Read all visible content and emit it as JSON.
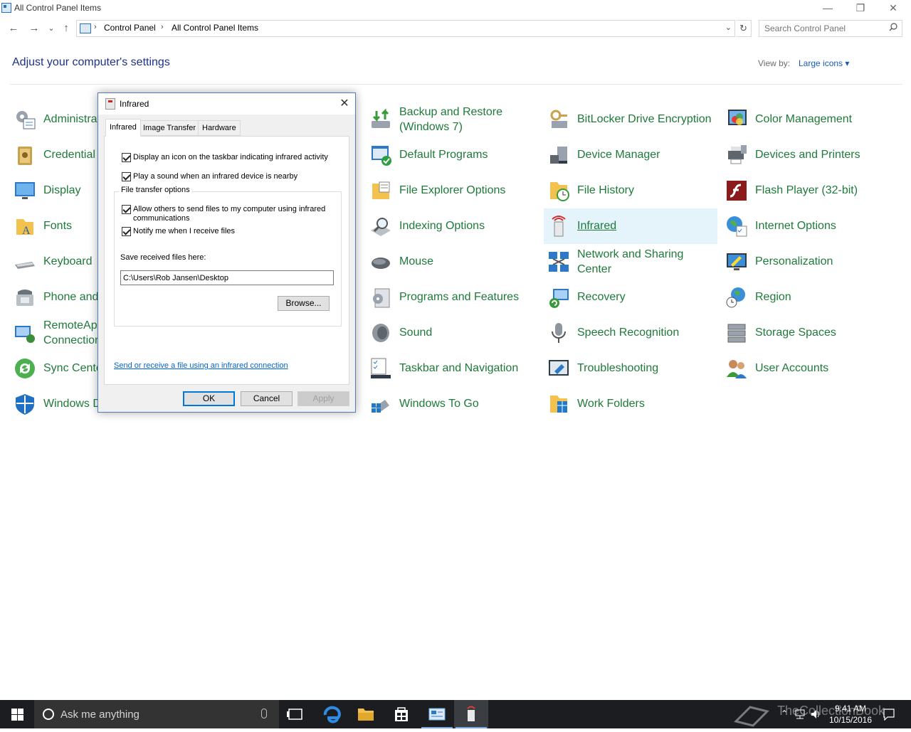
{
  "window": {
    "title": "All Control Panel Items",
    "controls": {
      "minimize": "—",
      "restore": "❐",
      "close": "✕"
    }
  },
  "nav": {
    "back": "←",
    "forward": "→",
    "recent": "⌄",
    "up": "↑",
    "breadcrumb": [
      "Control Panel",
      "All Control Panel Items"
    ],
    "refresh": "↻",
    "search_placeholder": "Search Control Panel"
  },
  "header": {
    "title": "Adjust your computer's settings",
    "view_by_label": "View by:",
    "view_by_value": "Large icons ▾"
  },
  "items": [
    {
      "label": "Administrative Tools",
      "icon": "admin-tools-icon"
    },
    {
      "label": "Credential Manager",
      "icon": "credential-icon"
    },
    {
      "label": "Display",
      "icon": "display-icon"
    },
    {
      "label": "Fonts",
      "icon": "fonts-icon"
    },
    {
      "label": "Keyboard",
      "icon": "keyboard-icon"
    },
    {
      "label": "Phone and Modem",
      "icon": "phone-icon"
    },
    {
      "label": "RemoteApp and Desktop Connections",
      "icon": "remoteapp-icon"
    },
    {
      "label": "Sync Center",
      "icon": "sync-icon"
    },
    {
      "label": "Windows Defender",
      "icon": "shield-icon"
    },
    {
      "label": "Backup and Restore (Windows 7)",
      "icon": "backup-icon"
    },
    {
      "label": "Default Programs",
      "icon": "default-programs-icon"
    },
    {
      "label": "File Explorer Options",
      "icon": "folder-options-icon"
    },
    {
      "label": "Indexing Options",
      "icon": "indexing-icon"
    },
    {
      "label": "Mouse",
      "icon": "mouse-icon"
    },
    {
      "label": "Programs and Features",
      "icon": "programs-icon"
    },
    {
      "label": "Sound",
      "icon": "speaker-icon"
    },
    {
      "label": "Taskbar and Navigation",
      "icon": "taskbar-icon"
    },
    {
      "label": "Windows To Go",
      "icon": "usb-icon"
    },
    {
      "label": "BitLocker Drive Encryption",
      "icon": "bitlocker-icon"
    },
    {
      "label": "Device Manager",
      "icon": "device-manager-icon"
    },
    {
      "label": "File History",
      "icon": "file-history-icon"
    },
    {
      "label": "Infrared",
      "icon": "infrared-icon"
    },
    {
      "label": "Network and Sharing Center",
      "icon": "network-icon"
    },
    {
      "label": "Recovery",
      "icon": "recovery-icon"
    },
    {
      "label": "Speech Recognition",
      "icon": "microphone-icon"
    },
    {
      "label": "Troubleshooting",
      "icon": "troubleshooting-icon"
    },
    {
      "label": "Work Folders",
      "icon": "work-folders-icon"
    },
    {
      "label": "Color Management",
      "icon": "color-management-icon"
    },
    {
      "label": "Devices and Printers",
      "icon": "printer-icon"
    },
    {
      "label": "Flash Player (32-bit)",
      "icon": "flash-icon"
    },
    {
      "label": "Internet Options",
      "icon": "globe-icon"
    },
    {
      "label": "Personalization",
      "icon": "personalization-icon"
    },
    {
      "label": "Region",
      "icon": "region-icon"
    },
    {
      "label": "Storage Spaces",
      "icon": "storage-icon"
    },
    {
      "label": "User Accounts",
      "icon": "users-icon"
    }
  ],
  "dialog": {
    "title": "Infrared",
    "close": "✕",
    "tabs": [
      "Infrared",
      "Image Transfer",
      "Hardware"
    ],
    "checkbox_icon": "Display an icon on the taskbar indicating infrared activity",
    "checkbox_sound": "Play a sound when an infrared device is nearby",
    "group_label": "File transfer options",
    "checkbox_allow": "Allow others to send files to my computer using infrared communications",
    "checkbox_notify": "Notify me when I receive files",
    "save_label": "Save received files here:",
    "save_path": "C:\\Users\\Rob Jansen\\Desktop",
    "browse": "Browse...",
    "link": "Send or receive a file using an infrared connection",
    "ok": "OK",
    "cancel": "Cancel",
    "apply": "Apply"
  },
  "taskbar": {
    "search_placeholder": "Ask me anything",
    "time": "9:41 AM",
    "date": "10/15/2016",
    "watermark": "TheCollectionBook"
  }
}
